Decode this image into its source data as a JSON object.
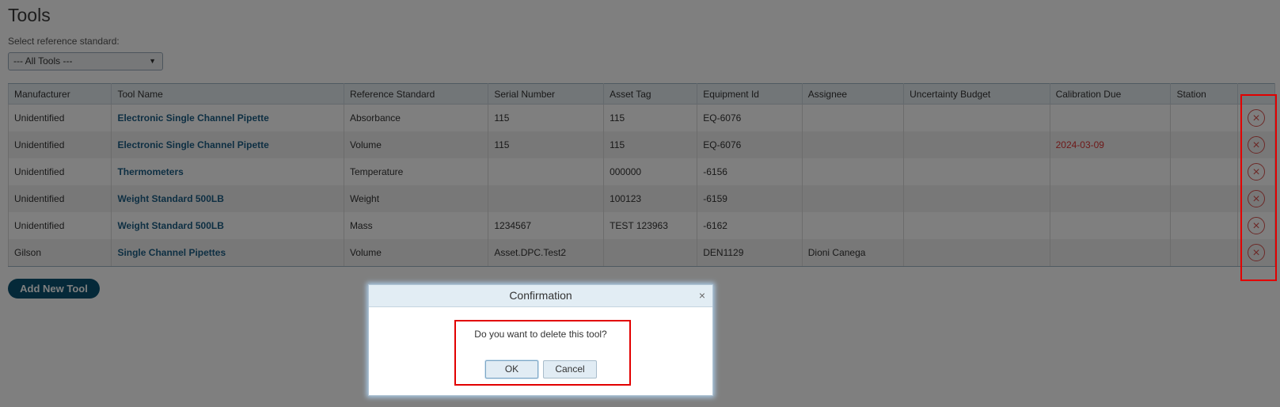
{
  "page": {
    "title": "Tools",
    "select_label": "Select reference standard:",
    "select_value": "--- All Tools ---",
    "add_button": "Add New Tool"
  },
  "table": {
    "headers": [
      "Manufacturer",
      "Tool Name",
      "Reference Standard",
      "Serial Number",
      "Asset Tag",
      "Equipment Id",
      "Assignee",
      "Uncertainty Budget",
      "Calibration Due",
      "Station"
    ],
    "rows": [
      {
        "manufacturer": "Unidentified",
        "tool_name": "Electronic Single Channel Pipette",
        "reference_standard": "Absorbance",
        "serial_number": "115",
        "asset_tag": "115",
        "equipment_id": "EQ-6076",
        "assignee": "",
        "uncertainty_budget": "",
        "calibration_due": "",
        "station": ""
      },
      {
        "manufacturer": "Unidentified",
        "tool_name": "Electronic Single Channel Pipette",
        "reference_standard": "Volume",
        "serial_number": "115",
        "asset_tag": "115",
        "equipment_id": "EQ-6076",
        "assignee": "",
        "uncertainty_budget": "",
        "calibration_due": "2024-03-09",
        "station": ""
      },
      {
        "manufacturer": "Unidentified",
        "tool_name": "Thermometers",
        "reference_standard": "Temperature",
        "serial_number": "",
        "asset_tag": "000000",
        "equipment_id": "-6156",
        "assignee": "",
        "uncertainty_budget": "",
        "calibration_due": "",
        "station": ""
      },
      {
        "manufacturer": "Unidentified",
        "tool_name": "Weight Standard 500LB",
        "reference_standard": "Weight",
        "serial_number": "",
        "asset_tag": "100123",
        "equipment_id": "-6159",
        "assignee": "",
        "uncertainty_budget": "",
        "calibration_due": "",
        "station": ""
      },
      {
        "manufacturer": "Unidentified",
        "tool_name": "Weight Standard 500LB",
        "reference_standard": "Mass",
        "serial_number": "1234567",
        "asset_tag": "TEST 123963",
        "equipment_id": "-6162",
        "assignee": "",
        "uncertainty_budget": "",
        "calibration_due": "",
        "station": ""
      },
      {
        "manufacturer": "Gilson",
        "tool_name": "Single Channel Pipettes",
        "reference_standard": "Volume",
        "serial_number": "Asset.DPC.Test2",
        "asset_tag": "",
        "equipment_id": "DEN1129",
        "assignee": "Dioni Canega",
        "uncertainty_budget": "",
        "calibration_due": "",
        "station": ""
      }
    ],
    "delete_icon": "×"
  },
  "dialog": {
    "title": "Confirmation",
    "close_icon": "×",
    "message": "Do you want to delete this tool?",
    "ok_label": "OK",
    "cancel_label": "Cancel"
  },
  "colors": {
    "link": "#1c5f86",
    "overdue": "#dd3333",
    "delete": "#d9534f",
    "primary_button": "#0b5372",
    "highlight": "#e20000"
  }
}
